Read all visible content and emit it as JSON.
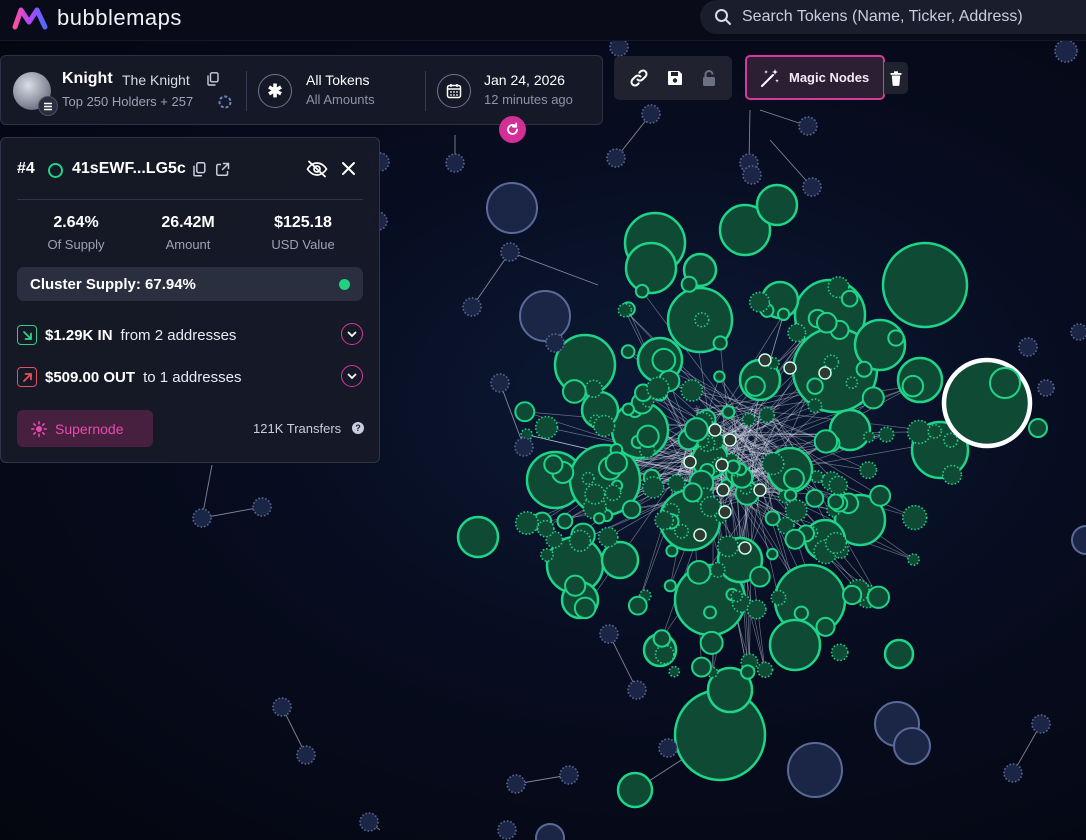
{
  "app": {
    "name": "bubblemaps"
  },
  "search": {
    "placeholder": "Search Tokens (Name, Ticker, Address)"
  },
  "token": {
    "name": "Knight",
    "subname": "The Knight",
    "holders": "Top 250 Holders + 257",
    "filter_title": "All Tokens",
    "filter_sub": "All Amounts",
    "date": "Jan 24, 2026",
    "updated": "12 minutes ago"
  },
  "toolbar": {
    "magic_label": "Magic Nodes",
    "icons": [
      "link-icon",
      "save-icon",
      "lock-icon",
      "magic-wand-icon",
      "trash-icon"
    ]
  },
  "panel": {
    "rank": "#4",
    "address": "41sEWF...LG5c",
    "stats": [
      {
        "value": "2.64%",
        "label": "Of Supply"
      },
      {
        "value": "26.42M",
        "label": "Amount"
      },
      {
        "value": "$125.18",
        "label": "USD Value"
      }
    ],
    "cluster_supply": "Cluster Supply: 67.94%",
    "inflow": {
      "amount": "$1.29K IN",
      "rest": "from 2 addresses"
    },
    "outflow": {
      "amount": "$509.00 OUT",
      "rest": "to 1 addresses"
    },
    "supernode_label": "Supernode",
    "transfers": "121K Transfers",
    "help": "?"
  },
  "colors": {
    "accent_pink": "#d6399b",
    "node_green": "#1ed489",
    "node_green_fill": "#0f4a35",
    "node_blue": "#3c4f7e",
    "inflow": "#2fcf8a",
    "outflow": "#e84f5c",
    "background": "#070c1f"
  }
}
